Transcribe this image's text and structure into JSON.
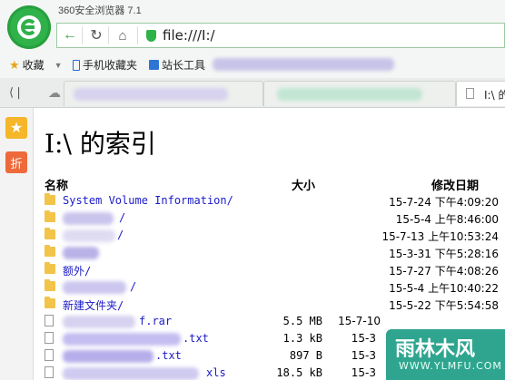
{
  "app": {
    "title": "360安全浏览器 7.1"
  },
  "address": {
    "url": "file:///I:/"
  },
  "bookmarks": {
    "favorites_label": "收藏",
    "mobile_label": "手机收藏夹",
    "webmaster_label": "站长工具"
  },
  "tabs": {
    "active_label": "I:\\ 的"
  },
  "sidebar": {
    "discount_label": "折"
  },
  "page": {
    "title": "I:\\ 的索引",
    "headers": {
      "name": "名称",
      "size": "大小",
      "modified": "修改日期"
    },
    "rows": [
      {
        "type": "folder",
        "name": "System Volume Information/",
        "size": "",
        "date": "15-7-24 下午4:09:20"
      },
      {
        "type": "folder",
        "name": "/",
        "size": "",
        "date": "15-5-4 上午8:46:00"
      },
      {
        "type": "folder",
        "name": "/",
        "size": "",
        "date": "15-7-13 上午10:53:24"
      },
      {
        "type": "folder",
        "name": "",
        "size": "",
        "date": "15-3-31 下午5:28:16"
      },
      {
        "type": "folder",
        "name": "额外/",
        "size": "",
        "date": "15-7-27 下午4:08:26"
      },
      {
        "type": "folder",
        "name": "/",
        "size": "",
        "date": "15-5-4 上午10:40:22"
      },
      {
        "type": "folder",
        "name": "新建文件夹/",
        "size": "",
        "date": "15-5-22 下午5:54:58"
      },
      {
        "type": "file",
        "name": "f.rar",
        "size": "5.5 MB",
        "date": "15-7-10"
      },
      {
        "type": "file",
        "name": ".txt",
        "size": "1.3 kB",
        "date": "15-3"
      },
      {
        "type": "file",
        "name": ".txt",
        "size": "897 B",
        "date": "15-3"
      },
      {
        "type": "file",
        "name": "xls",
        "size": "18.5 kB",
        "date": "15-3"
      }
    ]
  },
  "watermark": {
    "main": "雨林木风",
    "sub": "WWW.YLMFU.COM"
  },
  "colors": {
    "brand_green": "#2fb24a",
    "link_blue": "#1a1ac8",
    "folder_yellow": "#f2c44a",
    "watermark_teal": "#2fa58f"
  }
}
